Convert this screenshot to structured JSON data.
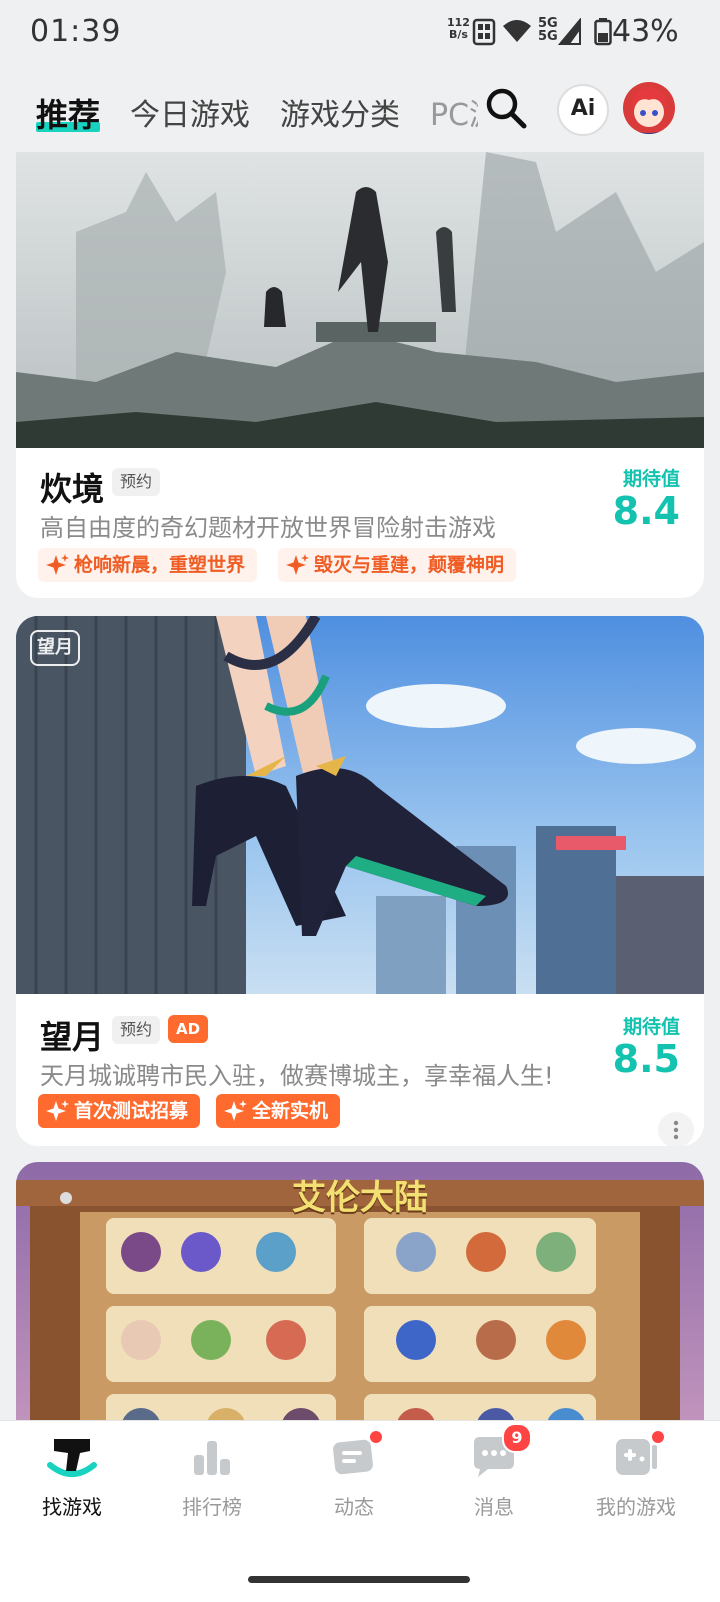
{
  "status_bar": {
    "time": "01:39",
    "net_speed_top": "112",
    "net_speed_bottom": "B/s",
    "sig1": "5G",
    "sig2": "5G",
    "battery": "43%"
  },
  "top_nav": {
    "tabs": [
      {
        "label": "推荐",
        "active": true
      },
      {
        "label": "今日游戏"
      },
      {
        "label": "游戏分类"
      },
      {
        "label": "PC游"
      }
    ],
    "ai_label": "Ai"
  },
  "cards": [
    {
      "title": "炊境",
      "chip": "预约",
      "desc": "高自由度的奇幻题材开放世界冒险射击游戏",
      "tags": [
        "枪响新晨，重塑世界",
        "毁灭与重建，颠覆神明"
      ],
      "expect_label": "期待值",
      "expect_value": "8.4"
    },
    {
      "title": "望月",
      "chip": "预约",
      "ad": "AD",
      "desc": "天月城诚聘市民入驻，做赛博城主，享幸福人生!",
      "tags": [
        "首次测试招募",
        "全新实机"
      ],
      "expect_label": "期待值",
      "expect_value": "8.5",
      "logo_text": "望月"
    },
    {
      "banner_title": "艾伦大陆"
    }
  ],
  "bottom_nav": [
    {
      "label": "找游戏",
      "active": true
    },
    {
      "label": "排行榜"
    },
    {
      "label": "动态",
      "dot": true
    },
    {
      "label": "消息",
      "badge": "9"
    },
    {
      "label": "我的游戏",
      "dot": true
    }
  ],
  "colors": {
    "accent": "#18d3c0",
    "expect": "#13c3b0",
    "tag_orange": "#ff6a2e",
    "badge_red": "#ff4444"
  }
}
